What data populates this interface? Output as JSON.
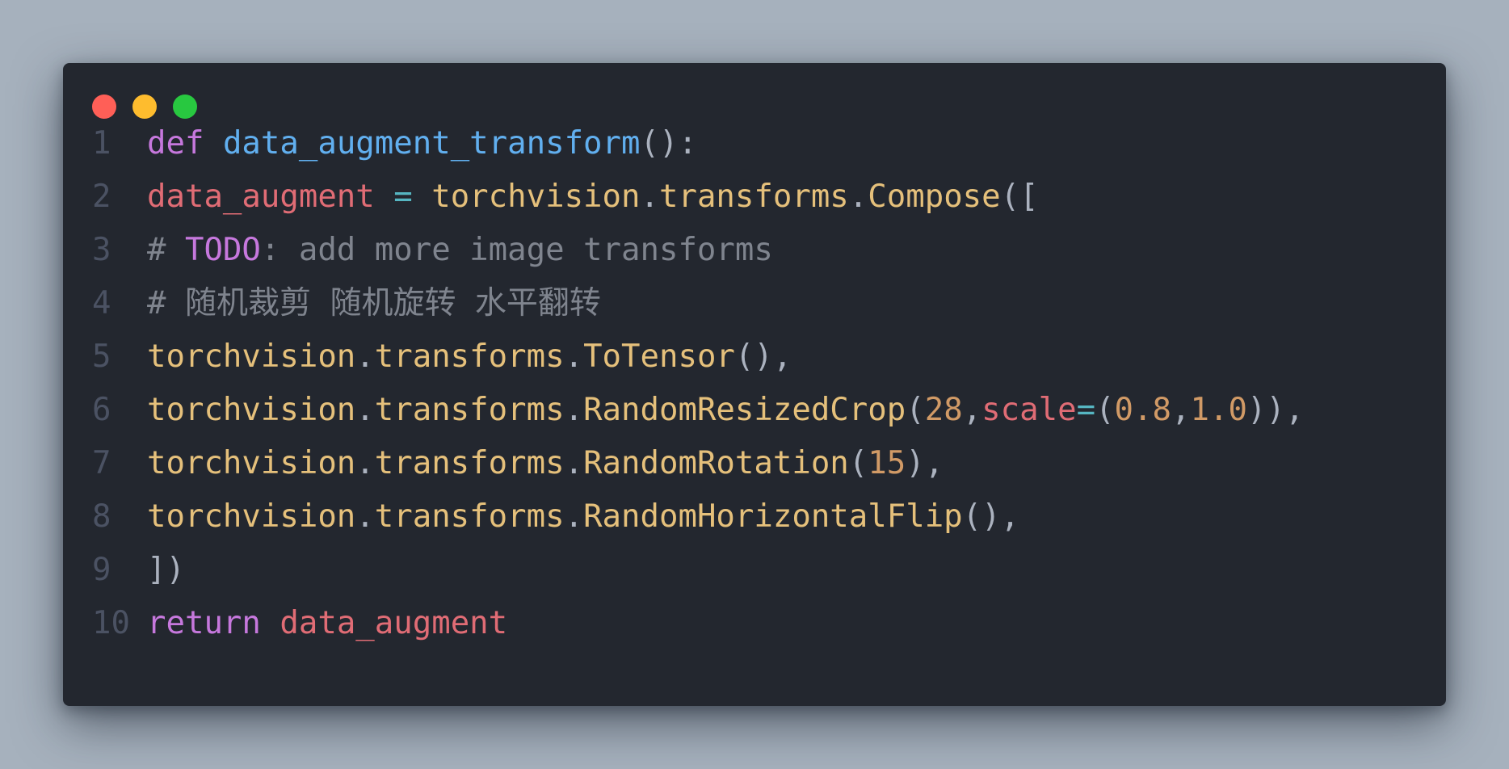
{
  "window": {
    "controls": {
      "close_color": "#ff5f57",
      "minimize_color": "#febc2e",
      "maximize_color": "#28c840"
    }
  },
  "theme": {
    "background": "#23272f",
    "page_background": "#a6b1bd",
    "keyword": "#c678dd",
    "function": "#61afef",
    "variable": "#e06c75",
    "operator": "#56b6c2",
    "module": "#e5c07b",
    "punctuation": "#abb2bf",
    "number": "#d19a66",
    "comment": "#7f848e",
    "line_number": "#4b5263"
  },
  "code": {
    "lines": [
      {
        "number": "1",
        "tokens": [
          {
            "t": "def",
            "c": "kw"
          },
          {
            "t": " ",
            "c": "pun"
          },
          {
            "t": "data_augment_transform",
            "c": "fn"
          },
          {
            "t": "():",
            "c": "pun"
          }
        ]
      },
      {
        "number": "2",
        "tokens": [
          {
            "t": "data_augment",
            "c": "var"
          },
          {
            "t": " ",
            "c": "pun"
          },
          {
            "t": "=",
            "c": "op"
          },
          {
            "t": " ",
            "c": "pun"
          },
          {
            "t": "torchvision",
            "c": "mod"
          },
          {
            "t": ".",
            "c": "pun"
          },
          {
            "t": "transforms",
            "c": "mod"
          },
          {
            "t": ".",
            "c": "pun"
          },
          {
            "t": "Compose",
            "c": "mod"
          },
          {
            "t": "([",
            "c": "pun"
          }
        ]
      },
      {
        "number": "3",
        "tokens": [
          {
            "t": "# ",
            "c": "cmt"
          },
          {
            "t": "TODO",
            "c": "todo"
          },
          {
            "t": ": add more image transforms",
            "c": "cmt"
          }
        ]
      },
      {
        "number": "4",
        "tokens": [
          {
            "t": "# 随机裁剪 随机旋转 水平翻转",
            "c": "cmt"
          }
        ]
      },
      {
        "number": "5",
        "tokens": [
          {
            "t": "torchvision",
            "c": "mod"
          },
          {
            "t": ".",
            "c": "pun"
          },
          {
            "t": "transforms",
            "c": "mod"
          },
          {
            "t": ".",
            "c": "pun"
          },
          {
            "t": "ToTensor",
            "c": "mod"
          },
          {
            "t": "(),",
            "c": "pun"
          }
        ]
      },
      {
        "number": "6",
        "tokens": [
          {
            "t": "torchvision",
            "c": "mod"
          },
          {
            "t": ".",
            "c": "pun"
          },
          {
            "t": "transforms",
            "c": "mod"
          },
          {
            "t": ".",
            "c": "pun"
          },
          {
            "t": "RandomResizedCrop",
            "c": "mod"
          },
          {
            "t": "(",
            "c": "pun"
          },
          {
            "t": "28",
            "c": "num"
          },
          {
            "t": ",",
            "c": "pun"
          },
          {
            "t": "scale",
            "c": "var"
          },
          {
            "t": "=",
            "c": "op"
          },
          {
            "t": "(",
            "c": "pun"
          },
          {
            "t": "0.8",
            "c": "num"
          },
          {
            "t": ",",
            "c": "pun"
          },
          {
            "t": "1.0",
            "c": "num"
          },
          {
            "t": ")),",
            "c": "pun"
          }
        ]
      },
      {
        "number": "7",
        "tokens": [
          {
            "t": "torchvision",
            "c": "mod"
          },
          {
            "t": ".",
            "c": "pun"
          },
          {
            "t": "transforms",
            "c": "mod"
          },
          {
            "t": ".",
            "c": "pun"
          },
          {
            "t": "RandomRotation",
            "c": "mod"
          },
          {
            "t": "(",
            "c": "pun"
          },
          {
            "t": "15",
            "c": "num"
          },
          {
            "t": "),",
            "c": "pun"
          }
        ]
      },
      {
        "number": "8",
        "tokens": [
          {
            "t": "torchvision",
            "c": "mod"
          },
          {
            "t": ".",
            "c": "pun"
          },
          {
            "t": "transforms",
            "c": "mod"
          },
          {
            "t": ".",
            "c": "pun"
          },
          {
            "t": "RandomHorizontalFlip",
            "c": "mod"
          },
          {
            "t": "(),",
            "c": "pun"
          }
        ]
      },
      {
        "number": "9",
        "tokens": [
          {
            "t": "])",
            "c": "pun"
          }
        ]
      },
      {
        "number": "10",
        "tokens": [
          {
            "t": "return",
            "c": "kw"
          },
          {
            "t": " ",
            "c": "pun"
          },
          {
            "t": "data_augment",
            "c": "var"
          }
        ]
      }
    ]
  }
}
